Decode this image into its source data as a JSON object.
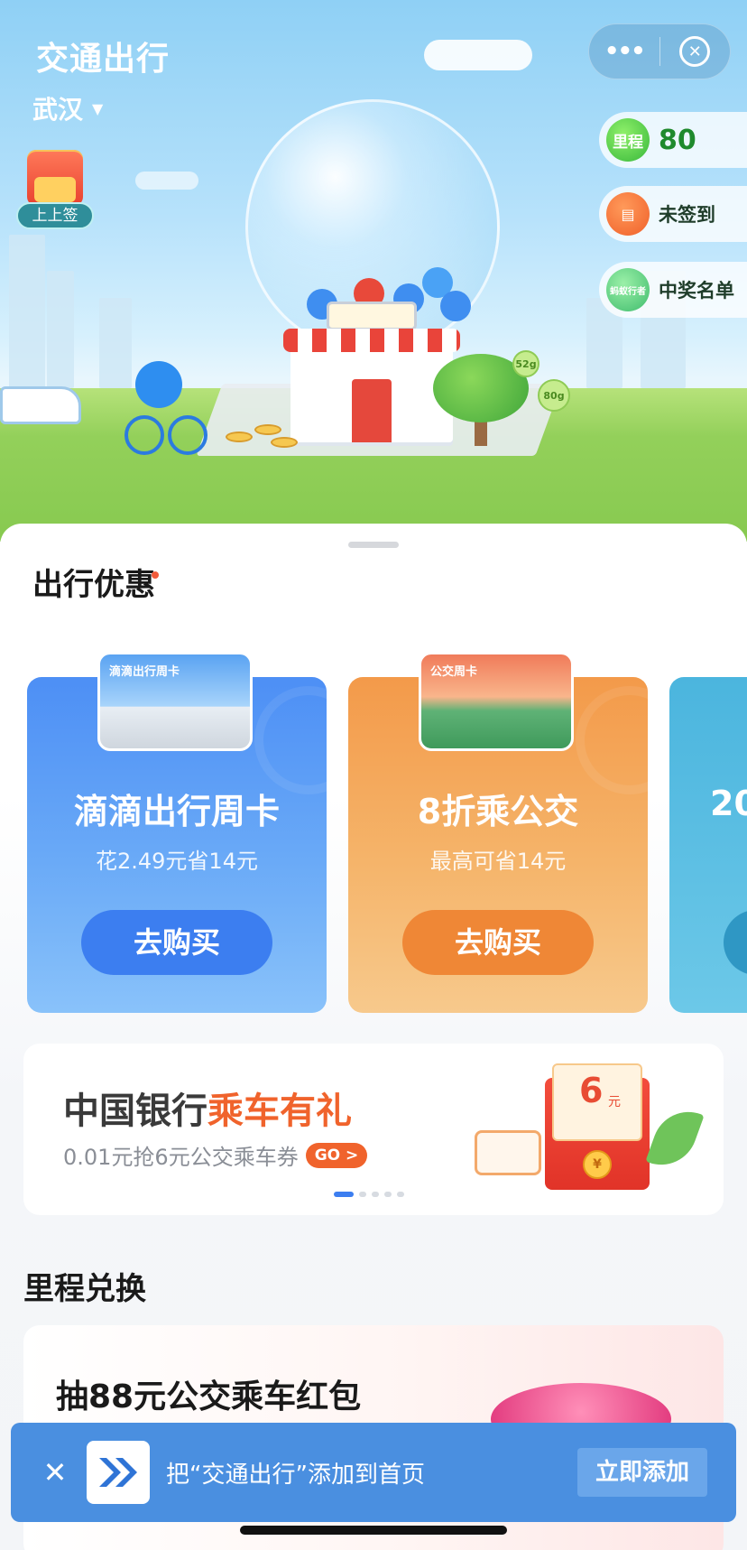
{
  "header": {
    "title": "交通出行",
    "city": "武汉",
    "more_icon": "more-dots-icon",
    "close_icon": "target-close-icon"
  },
  "hero": {
    "fortune_label": "上上签",
    "mileage_label": "里程",
    "mileage_value": "80",
    "signin_label": "未签到",
    "winners_label": "中奖名单",
    "winners_icon_text": "蚂蚁行者",
    "bubble1": "52g",
    "bubble2": "80g"
  },
  "offers": {
    "title": "出行优惠",
    "cards": [
      {
        "thumb_label": "滴滴出行周卡",
        "name": "滴滴出行周卡",
        "sub": "花2.49元省14元",
        "button": "去购买",
        "color": "#4d8ff5"
      },
      {
        "thumb_label": "公交周卡",
        "name": "8折乘公交",
        "sub": "最高可省14元",
        "button": "去购买",
        "color": "#f39a4a"
      },
      {
        "thumb_label": "",
        "name": "20",
        "sub": "",
        "button": "",
        "color": "#4bb5de"
      }
    ]
  },
  "banner": {
    "title_plain": "中国银行",
    "title_highlight": "乘车有礼",
    "subtitle": "0.01元抢6元公交乘车券",
    "go_label": "GO >",
    "amount": "6",
    "unit": "元",
    "coin_symbol": "¥",
    "active_dot": 0,
    "dot_count": 5
  },
  "mileage_exchange": {
    "title": "里程兑换",
    "lottery_title": "抽88元公交乘车红包"
  },
  "add_bar": {
    "close_icon": "close-x-icon",
    "text": "把“交通出行”添加到首页",
    "button": "立即添加",
    "bg_color": "#4a8fe0"
  }
}
